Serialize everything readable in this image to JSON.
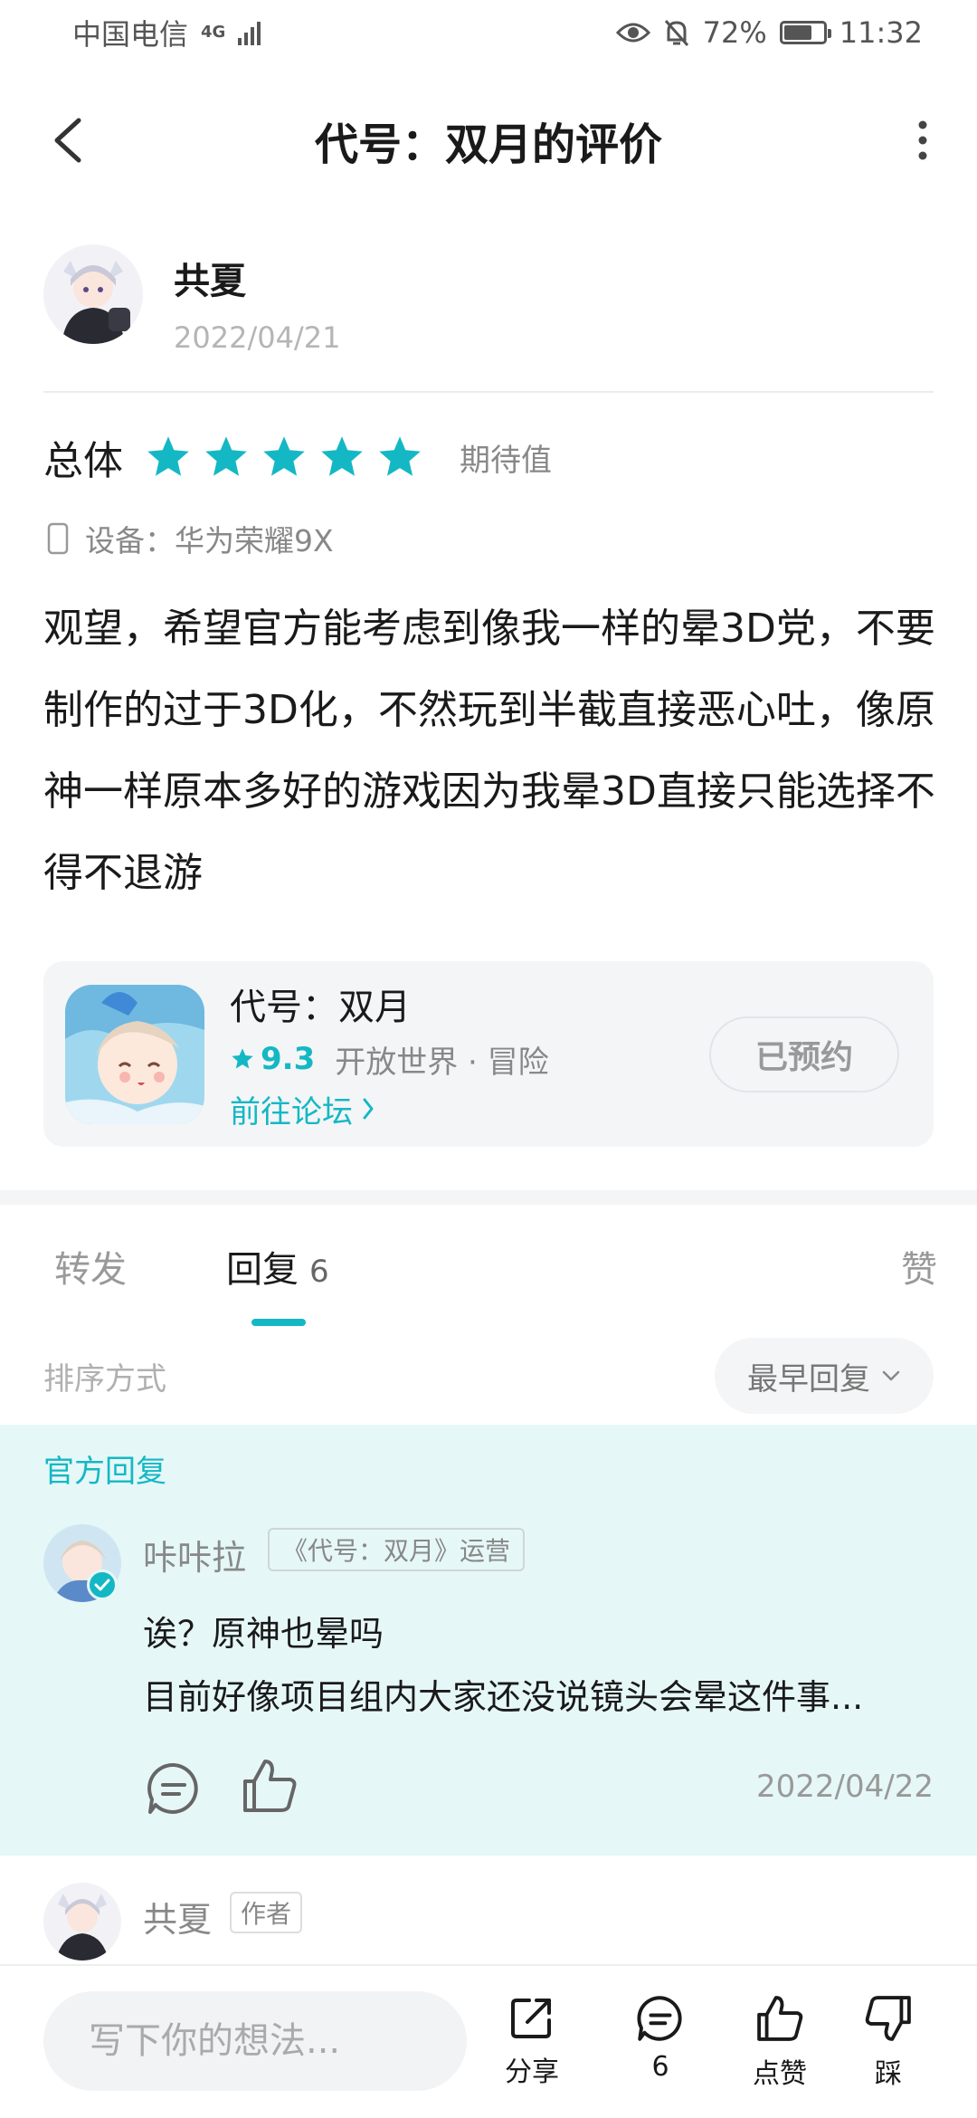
{
  "status_bar": {
    "carrier": "中国电信",
    "network": "4G",
    "battery_percent": "72%",
    "time": "11:32",
    "battery_level": 0.72
  },
  "header": {
    "title": "代号：双月的评价"
  },
  "author": {
    "name": "共夏",
    "date": "2022/04/21"
  },
  "rating": {
    "label": "总体",
    "stars": 5,
    "max_stars": 5,
    "note": "期待值"
  },
  "device": {
    "label": "设备：华为荣耀9X"
  },
  "review": {
    "text": "观望，希望官方能考虑到像我一样的晕3D党，不要制作的过于3D化，不然玩到半截直接恶心吐，像原神一样原本多好的游戏因为我晕3D直接只能选择不得不退游"
  },
  "game": {
    "name": "代号：双月",
    "score": "9.3",
    "tags": "开放世界 · 冒险",
    "forum_link": "前往论坛",
    "reserve_button": "已预约"
  },
  "tabs": [
    {
      "label": "转发"
    },
    {
      "label": "回复",
      "count": "6"
    },
    {
      "label": "赞"
    }
  ],
  "sort": {
    "label": "排序方式",
    "selected": "最早回复"
  },
  "official_reply": {
    "section_label": "官方回复",
    "name": "咔咔拉",
    "role": "《代号：双月》运营",
    "line1": "诶？原神也晕吗",
    "line2": "目前好像项目组内大家还没说镜头会晕这件事...",
    "date": "2022/04/22"
  },
  "second_reply": {
    "name": "共夏",
    "tag": "作者"
  },
  "bottom_bar": {
    "input_placeholder": "写下你的想法...",
    "share_label": "分享",
    "comment_count": "6",
    "like_label": "点赞",
    "dislike_label": "踩"
  },
  "colors": {
    "accent": "#14b8c4",
    "official_bg": "#e6f7f8"
  }
}
